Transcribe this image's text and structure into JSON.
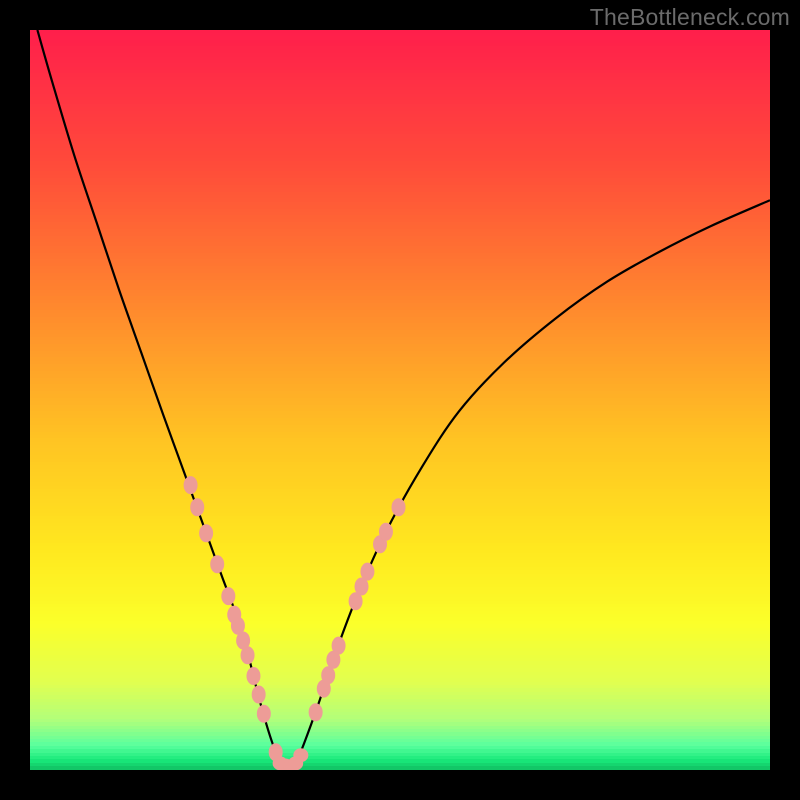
{
  "watermark": "TheBottleneck.com",
  "colors": {
    "marker": "#ed9c97",
    "curve": "#000000",
    "frame": "#000000"
  },
  "chart_data": {
    "type": "line",
    "title": "",
    "xlabel": "",
    "ylabel": "",
    "xlim": [
      0,
      100
    ],
    "ylim": [
      0,
      100
    ],
    "gradient_stops": [
      {
        "pos": 0.0,
        "color": "#ff1f4b"
      },
      {
        "pos": 0.18,
        "color": "#ff4b3a"
      },
      {
        "pos": 0.38,
        "color": "#ff8b2d"
      },
      {
        "pos": 0.55,
        "color": "#ffc323"
      },
      {
        "pos": 0.7,
        "color": "#ffe81f"
      },
      {
        "pos": 0.8,
        "color": "#fbff2a"
      },
      {
        "pos": 0.88,
        "color": "#e1ff50"
      },
      {
        "pos": 0.93,
        "color": "#b2ff7a"
      },
      {
        "pos": 0.965,
        "color": "#5aff9e"
      },
      {
        "pos": 0.985,
        "color": "#19e97a"
      },
      {
        "pos": 1.0,
        "color": "#0fb85f"
      }
    ],
    "series": [
      {
        "name": "bottleneck-curve",
        "x": [
          1,
          3,
          6,
          9,
          12,
          15,
          18,
          20,
          22,
          24,
          26,
          27.5,
          29,
          30,
          31,
          32,
          33,
          34,
          35,
          36,
          37,
          39,
          41,
          44,
          48,
          53,
          58,
          64,
          71,
          78,
          85,
          92,
          100
        ],
        "y": [
          100,
          93,
          83,
          74,
          65,
          56.5,
          48,
          42.5,
          37,
          31.5,
          26,
          22,
          17.5,
          13.5,
          9.5,
          6,
          3,
          1.2,
          0.5,
          1.2,
          3.5,
          9,
          15,
          23,
          32,
          41,
          48.5,
          55,
          61,
          66,
          70,
          73.5,
          77
        ]
      }
    ],
    "markers_left": [
      {
        "x": 21.7,
        "y": 38.5
      },
      {
        "x": 22.6,
        "y": 35.5
      },
      {
        "x": 23.8,
        "y": 32.0
      },
      {
        "x": 25.3,
        "y": 27.8
      },
      {
        "x": 26.8,
        "y": 23.5
      },
      {
        "x": 27.6,
        "y": 21.0
      },
      {
        "x": 28.1,
        "y": 19.5
      },
      {
        "x": 28.8,
        "y": 17.5
      },
      {
        "x": 29.4,
        "y": 15.5
      },
      {
        "x": 30.2,
        "y": 12.7
      },
      {
        "x": 30.9,
        "y": 10.2
      },
      {
        "x": 31.6,
        "y": 7.6
      },
      {
        "x": 33.2,
        "y": 2.4
      }
    ],
    "markers_bottom": [
      {
        "x": 33.8,
        "y": 0.9
      },
      {
        "x": 34.5,
        "y": 0.6
      },
      {
        "x": 35.2,
        "y": 0.5
      },
      {
        "x": 35.9,
        "y": 0.9
      },
      {
        "x": 36.6,
        "y": 2.0
      }
    ],
    "markers_right": [
      {
        "x": 38.6,
        "y": 7.8
      },
      {
        "x": 39.7,
        "y": 11.0
      },
      {
        "x": 40.3,
        "y": 12.8
      },
      {
        "x": 41.0,
        "y": 14.9
      },
      {
        "x": 41.7,
        "y": 16.8
      },
      {
        "x": 44.0,
        "y": 22.8
      },
      {
        "x": 44.8,
        "y": 24.8
      },
      {
        "x": 45.6,
        "y": 26.8
      },
      {
        "x": 47.3,
        "y": 30.5
      },
      {
        "x": 48.1,
        "y": 32.2
      },
      {
        "x": 49.8,
        "y": 35.5
      }
    ]
  }
}
